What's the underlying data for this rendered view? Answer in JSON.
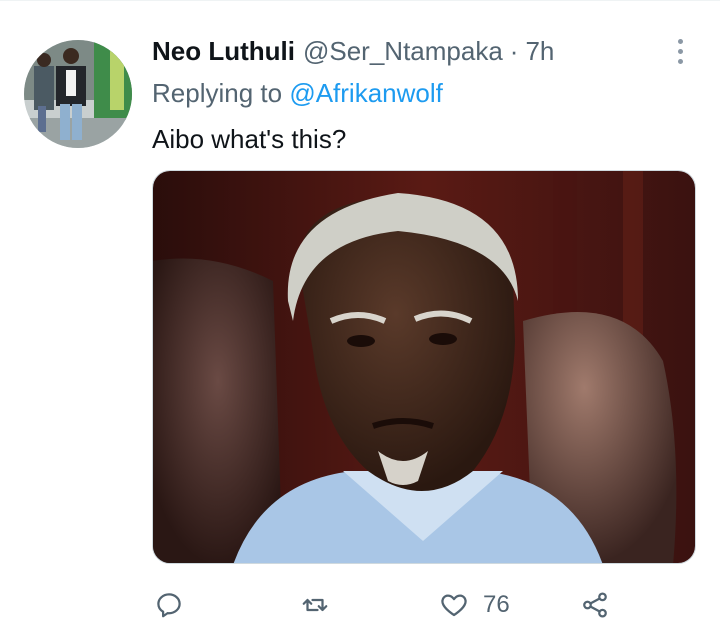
{
  "tweet": {
    "display_name": "Neo Luthuli",
    "handle": "@Ser_Ntampaka",
    "separator": "·",
    "time": "7h",
    "reply_prefix": "Replying to",
    "reply_to": "@Afrikanwolf",
    "text": "Aibo what's this?"
  },
  "actions": {
    "reply_icon": "reply-icon",
    "retweet_icon": "retweet-icon",
    "like_icon": "heart-icon",
    "like_count": "76",
    "share_icon": "share-icon"
  },
  "colors": {
    "link": "#1d9bf0",
    "secondary_text": "#536471",
    "primary_text": "#0f1419"
  }
}
